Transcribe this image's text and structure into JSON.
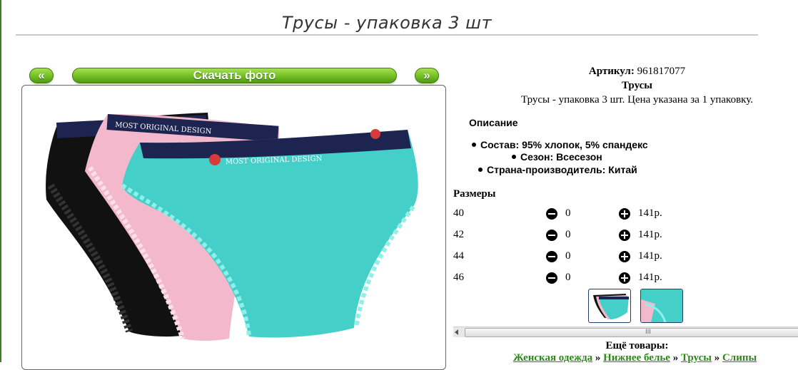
{
  "page": {
    "title": "Трусы - упаковка 3 шт"
  },
  "gallery": {
    "prev_label": "«",
    "download_label": "Скачать фото",
    "next_label": "»",
    "waistband_text": "MOST ORIGINAL DESIGN",
    "waistband_text_front": "MOST ORIGINAL DESIGN",
    "colors": {
      "button_green": "#7cc52a",
      "turquoise": "#45cfc9",
      "pink": "#f4b8cc",
      "black": "#111111",
      "navy_band": "#1d2450"
    }
  },
  "product": {
    "article_label": "Артикул:",
    "article_value": "961817077",
    "type": "Трусы",
    "description_line": "Трусы - упаковка 3 шт. Цена указана за 1 упаковку.",
    "description_heading": "Описание",
    "specs": [
      "Состав: 95% хлопок, 5% спандекс",
      "Сезон: Всесезон",
      "Страна-производитель: Китай"
    ]
  },
  "sizes": {
    "heading": "Размеры",
    "rows": [
      {
        "size": "40",
        "qty": "0",
        "price": "141р."
      },
      {
        "size": "42",
        "qty": "0",
        "price": "141р."
      },
      {
        "size": "44",
        "qty": "0",
        "price": "141р."
      },
      {
        "size": "46",
        "qty": "0",
        "price": "141р."
      }
    ],
    "icons": {
      "decrease": "minus-circle-icon",
      "increase": "plus-circle-icon"
    }
  },
  "more": {
    "heading": "Ещё товары:",
    "breadcrumbs": [
      "Женская одежда",
      "Нижнее белье",
      "Трусы",
      "Слипы"
    ],
    "separator": "»",
    "link_color": "#2a8a13"
  },
  "scrollbar": {
    "grip": "III"
  }
}
